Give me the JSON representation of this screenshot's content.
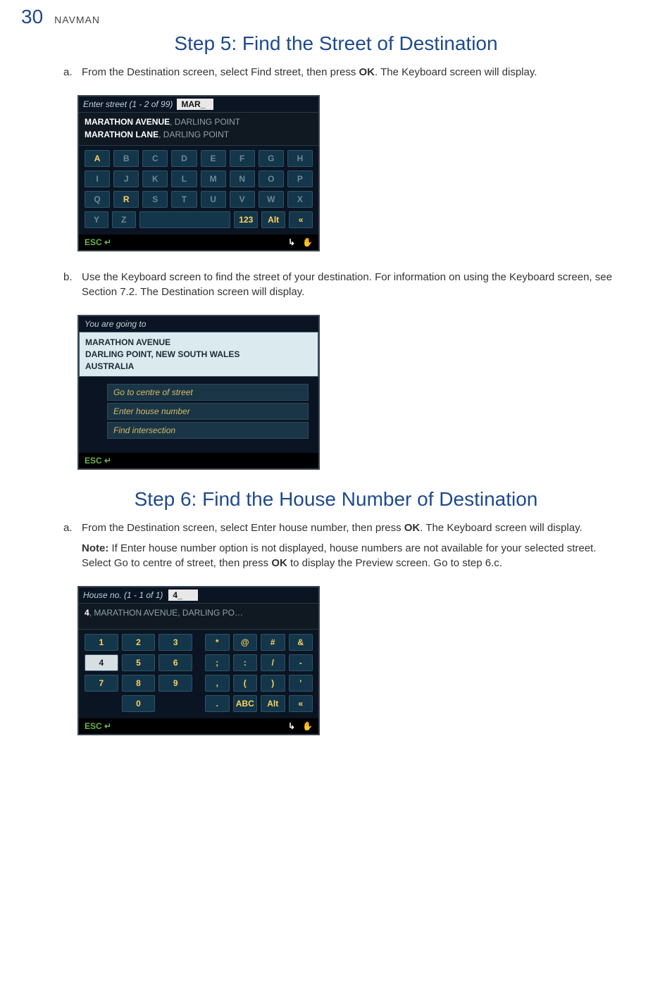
{
  "header": {
    "page_number": "30",
    "brand": "NAVMAN"
  },
  "step5": {
    "title": "Step 5: Find the Street of Destination",
    "a": {
      "letter": "a.",
      "text_pre": "From the Destination screen, select Find street, then press ",
      "ok": "OK",
      "text_post": ". The Keyboard screen will display."
    },
    "b": {
      "letter": "b.",
      "text": "Use the Keyboard screen to find the street of your destination. For information on using the Keyboard screen, see Section 7.2. The Destination screen will display."
    }
  },
  "kb1": {
    "title_left": "Enter street (1 - 2 of 99)",
    "input_value": "MAR_",
    "results": [
      {
        "bold": "MARATHON AVENUE",
        "rest": ", DARLING POINT"
      },
      {
        "bold": "MARATHON LANE",
        "rest": ", DARLING POINT"
      }
    ],
    "rows": [
      [
        "A",
        "B",
        "C",
        "D",
        "E",
        "F",
        "G",
        "H"
      ],
      [
        "I",
        "J",
        "K",
        "L",
        "M",
        "N",
        "O",
        "P"
      ],
      [
        "Q",
        "R",
        "S",
        "T",
        "U",
        "V",
        "W",
        "X"
      ],
      [
        "Y",
        "Z",
        "space",
        "",
        "",
        "123",
        "Alt",
        "«"
      ]
    ],
    "footer": {
      "esc": "ESC ↵",
      "arrow": "↳",
      "hand": "✋"
    }
  },
  "dest": {
    "title": "You are going to",
    "line1": "MARATHON AVENUE",
    "line2": "DARLING POINT, NEW SOUTH WALES",
    "line3": "AUSTRALIA",
    "options": [
      "Go to centre of street",
      "Enter house number",
      "Find intersection"
    ],
    "footer_esc": "ESC ↵"
  },
  "step6": {
    "title": "Step 6: Find the House Number of Destination",
    "a": {
      "letter": "a.",
      "text1_pre": "From the Destination screen, select Enter house number, then press ",
      "ok1": "OK",
      "text1_post": ". The Keyboard screen will display.",
      "note_label": "Note:",
      "note_body_pre": " If Enter house number option is not displayed, house numbers are not available for your selected street. Select Go to centre of street, then press ",
      "ok2": "OK",
      "note_body_post": " to display the Preview screen. Go to step 6.c."
    }
  },
  "hn": {
    "title_left": "House no.  (1 - 1 of 1)",
    "input_value": "4_",
    "result": {
      "bold": "4",
      "rest": ", MARATHON AVENUE, DARLING PO…"
    },
    "numpad": [
      [
        "1",
        "2",
        "3"
      ],
      [
        "4",
        "5",
        "6"
      ],
      [
        "7",
        "8",
        "9"
      ],
      [
        "",
        "0",
        ""
      ]
    ],
    "sympad": [
      [
        "*",
        "@",
        "#",
        "&"
      ],
      [
        ";",
        ":",
        "/",
        "-"
      ],
      [
        ",",
        "(",
        ")",
        "'"
      ],
      [
        ".",
        "ABC",
        "Alt",
        "«"
      ]
    ],
    "footer": {
      "esc": "ESC ↵",
      "arrow": "↳",
      "hand": "✋"
    }
  }
}
